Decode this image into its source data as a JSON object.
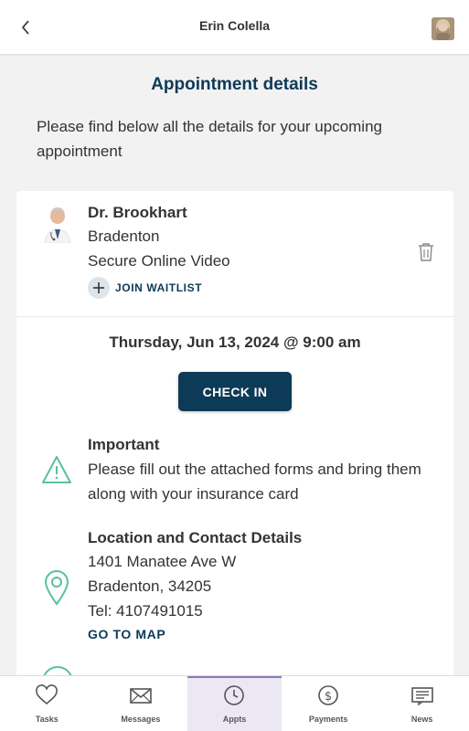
{
  "header": {
    "title": "Erin Colella"
  },
  "page": {
    "title": "Appointment details",
    "intro": "Please find below all the details for your upcoming appointment"
  },
  "appointment": {
    "doctor_name": "Dr. Brookhart",
    "location": "Bradenton",
    "visit_type": "Secure Online Video",
    "waitlist_label": "JOIN WAITLIST",
    "datetime": "Thursday, Jun 13, 2024 @ 9:00 am",
    "checkin_label": "CHECK IN"
  },
  "important": {
    "title": "Important",
    "text": "Please fill out the attached forms and bring them along with your insurance card"
  },
  "location_contact": {
    "title": "Location and Contact Details",
    "address_line1": "1401 Manatee Ave W",
    "address_line2": "Bradenton, 34205",
    "phone": "Tel: 4107491015",
    "map_label": "GO TO MAP"
  },
  "nav": [
    {
      "label": "Tasks",
      "icon": "heart-icon"
    },
    {
      "label": "Messages",
      "icon": "envelope-icon"
    },
    {
      "label": "Appts",
      "icon": "clock-icon",
      "active": true
    },
    {
      "label": "Payments",
      "icon": "dollar-icon"
    },
    {
      "label": "News",
      "icon": "news-icon"
    }
  ],
  "colors": {
    "accent": "#0d3a57",
    "icon_teal": "#5bbfa2",
    "active_nav_bg": "#ebe7f3",
    "active_nav_border": "#8c7ab8"
  }
}
